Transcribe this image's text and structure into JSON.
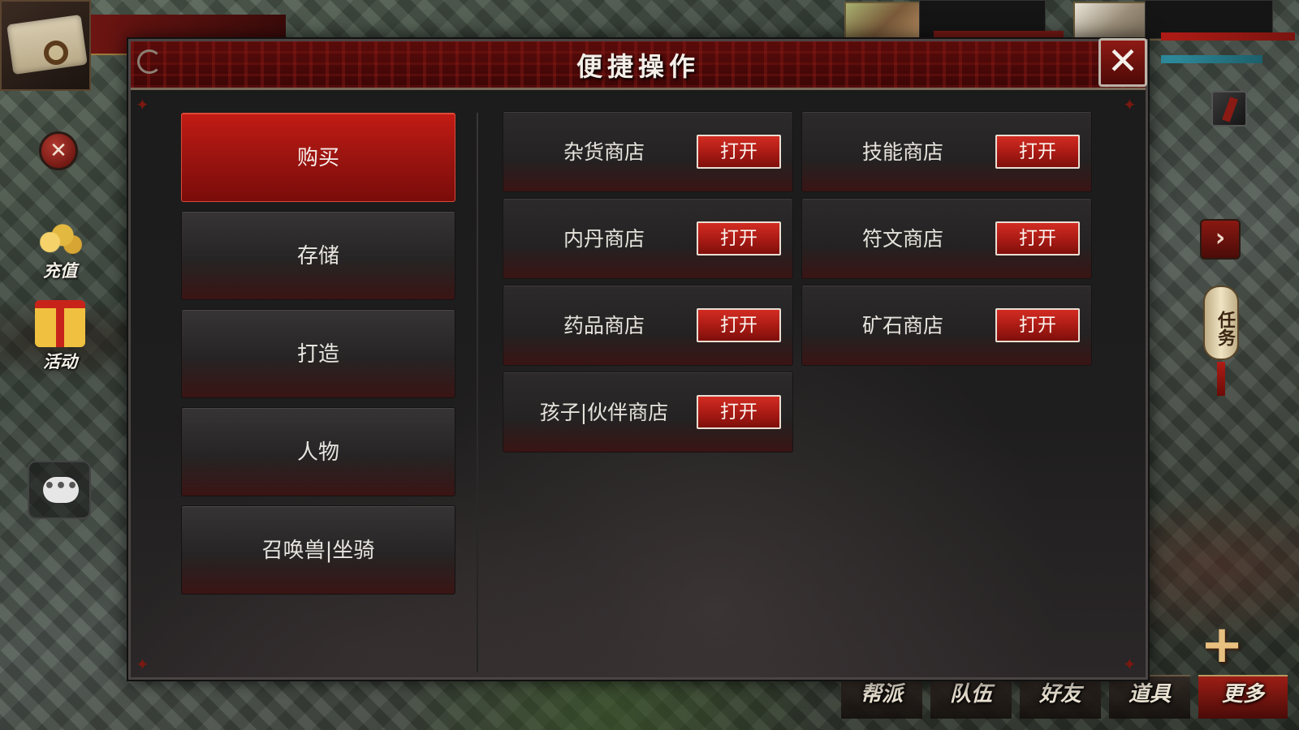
{
  "dialog": {
    "title": "便捷操作",
    "close_icon": "✕"
  },
  "categories": [
    {
      "label": "购买",
      "active": true
    },
    {
      "label": "存储",
      "active": false
    },
    {
      "label": "打造",
      "active": false
    },
    {
      "label": "人物",
      "active": false
    },
    {
      "label": "召唤兽|坐骑",
      "active": false
    }
  ],
  "shops": [
    {
      "name": "杂货商店",
      "button": "打开"
    },
    {
      "name": "技能商店",
      "button": "打开"
    },
    {
      "name": "内丹商店",
      "button": "打开"
    },
    {
      "name": "符文商店",
      "button": "打开"
    },
    {
      "name": "药品商店",
      "button": "打开"
    },
    {
      "name": "矿石商店",
      "button": "打开"
    },
    {
      "name": "孩子|伙伴商店",
      "button": "打开"
    }
  ],
  "hud": {
    "recharge_label": "充值",
    "activity_label": "活动",
    "task_label": "任务",
    "bottom_buttons": [
      "帮派",
      "队伍",
      "好友",
      "道具",
      "更多"
    ],
    "close_x": "✕",
    "arrow": "›",
    "plus": "+"
  },
  "colors": {
    "accent_red": "#c21b14",
    "button_red": "#a81a14",
    "panel_dark": "#1f1e1e"
  }
}
